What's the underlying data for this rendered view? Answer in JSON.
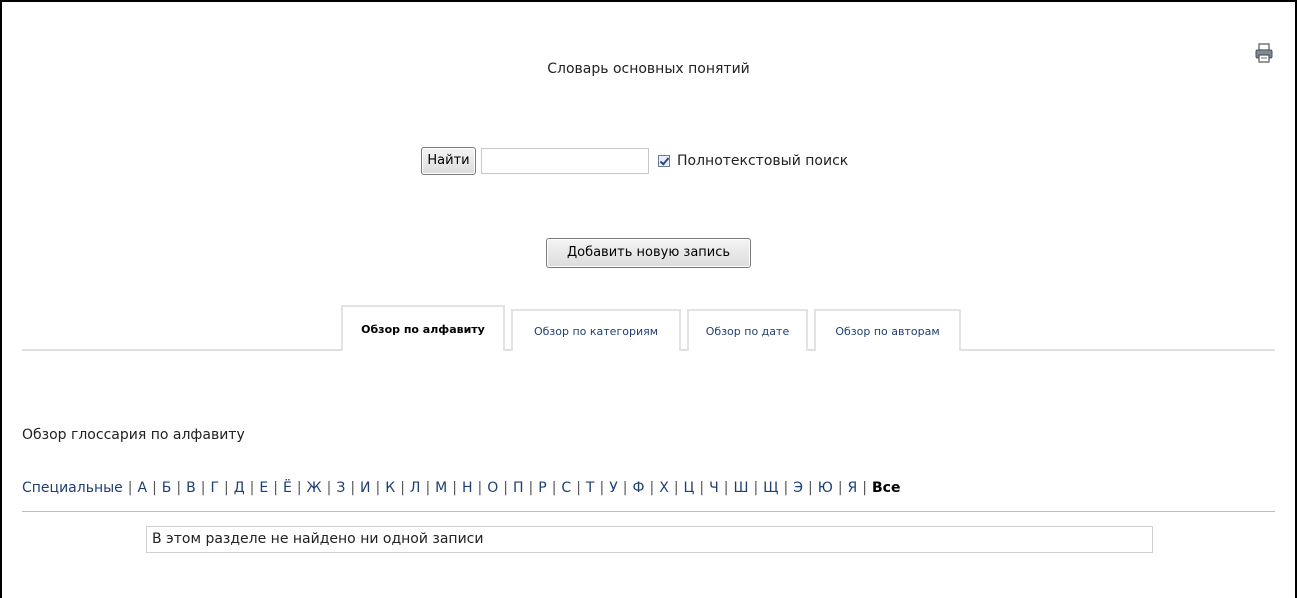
{
  "page": {
    "title": "Словарь основных понятий",
    "print_icon": "printer-icon"
  },
  "search": {
    "button_label": "Найти",
    "input_value": "",
    "fulltext_checked": true,
    "fulltext_label": "Полнотекстовый поиск"
  },
  "actions": {
    "add_entry_label": "Добавить новую запись"
  },
  "tabs": [
    {
      "label": "Обзор по алфавиту",
      "active": true
    },
    {
      "label": "Обзор по категориям",
      "active": false
    },
    {
      "label": "Обзор по дате",
      "active": false
    },
    {
      "label": "Обзор по авторам",
      "active": false
    }
  ],
  "browse": {
    "heading": "Обзор глоссария по алфавиту",
    "letters": [
      "Специальные",
      "А",
      "Б",
      "В",
      "Г",
      "Д",
      "Е",
      "Ё",
      "Ж",
      "З",
      "И",
      "К",
      "Л",
      "М",
      "Н",
      "О",
      "П",
      "Р",
      "С",
      "Т",
      "У",
      "Ф",
      "Х",
      "Ц",
      "Ч",
      "Ш",
      "Щ",
      "Э",
      "Ю",
      "Я"
    ],
    "all_label": "Все",
    "empty_message": "В этом разделе не найдено ни одной записи"
  },
  "colors": {
    "link": "#1f3f72",
    "tab_border": "#e3e3e3"
  }
}
